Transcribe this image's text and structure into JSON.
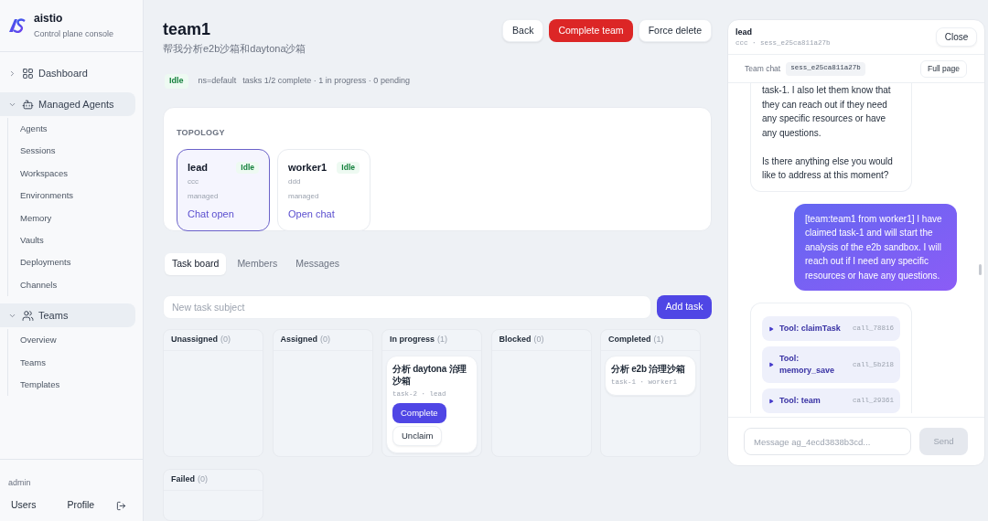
{
  "sidebar": {
    "brand": {
      "name": "aistio",
      "subtitle": "Control plane console"
    },
    "nav": [
      {
        "label": "Dashboard",
        "expanded": false
      },
      {
        "label": "Managed Agents",
        "expanded": true,
        "children": [
          "Agents",
          "Sessions",
          "Workspaces",
          "Environments",
          "Memory",
          "Vaults",
          "Deployments",
          "Channels"
        ]
      },
      {
        "label": "Teams",
        "expanded": true,
        "children": [
          "Overview",
          "Teams",
          "Templates"
        ]
      }
    ],
    "footer": {
      "user": "admin",
      "links": [
        "Users",
        "Profile"
      ]
    }
  },
  "header": {
    "title": "team1",
    "subtitle": "帮我分析e2b沙箱和daytona沙箱",
    "actions": [
      {
        "label": "Back",
        "kind": "default"
      },
      {
        "label": "Complete team",
        "kind": "danger"
      },
      {
        "label": "Force delete",
        "kind": "default"
      }
    ]
  },
  "status": {
    "badge": "Idle",
    "namespace": "ns=default",
    "summary": "tasks 1/2 complete · 1 in progress · 0 pending"
  },
  "topology": {
    "heading": "TOPOLOGY",
    "agents": [
      {
        "name": "lead",
        "status": "Idle",
        "model": "ccc",
        "type": "managed",
        "action": "Chat open",
        "selected": true
      },
      {
        "name": "worker1",
        "status": "Idle",
        "model": "ddd",
        "type": "managed",
        "action": "Open chat",
        "selected": false
      }
    ]
  },
  "tabs": [
    {
      "label": "Task board",
      "selected": true
    },
    {
      "label": "Members",
      "selected": false
    },
    {
      "label": "Messages",
      "selected": false
    }
  ],
  "task_form": {
    "placeholder": "New task subject",
    "button": "Add task"
  },
  "board": {
    "columns": [
      {
        "title": "Unassigned",
        "count": "(0)"
      },
      {
        "title": "Assigned",
        "count": "(0)"
      },
      {
        "title": "In progress",
        "count": "(1)",
        "tasks": [
          {
            "subject": "分析 daytona 治理沙箱",
            "meta": "task-2 · lead",
            "actions": [
              {
                "label": "Complete",
                "kind": "primary"
              },
              {
                "label": "Unclaim",
                "kind": "secondary"
              }
            ]
          }
        ]
      },
      {
        "title": "Blocked",
        "count": "(0)"
      },
      {
        "title": "Completed",
        "count": "(1)",
        "tasks": [
          {
            "subject": "分析 e2b 治理沙箱",
            "meta": "task-1 · worker1"
          }
        ]
      },
      {
        "title": "Failed",
        "count": "(0)"
      }
    ]
  },
  "chat": {
    "agent": "lead",
    "meta": "ccc · sess_e25ca811a27b",
    "close": "Close",
    "bar": {
      "label": "Team chat",
      "session": "sess_e25ca811a27b",
      "button": "Full page"
    },
    "messages": [
      {
        "kind": "reply",
        "paragraphs": [
          "task-1. I also let them know that they can reach out if they need any specific resources or have any questions.",
          "Is there anything else you would like to address at this moment?"
        ]
      },
      {
        "kind": "prompt",
        "paragraphs": [
          "[team:team1 from worker1] I have claimed task-1 and will start the analysis of the e2b sandbox. I will reach out if I need any specific resources or have any questions."
        ]
      },
      {
        "kind": "tools",
        "tools": [
          {
            "name": "Tool: claimTask",
            "call": "call_78816"
          },
          {
            "name": "Tool: memory_save",
            "call": "call_5b218"
          },
          {
            "name": "Tool: team",
            "call": "call_29361"
          }
        ]
      }
    ],
    "composer": {
      "placeholder": "Message ag_4ecd3838b3cd...",
      "send": "Send",
      "disabled": true
    }
  }
}
